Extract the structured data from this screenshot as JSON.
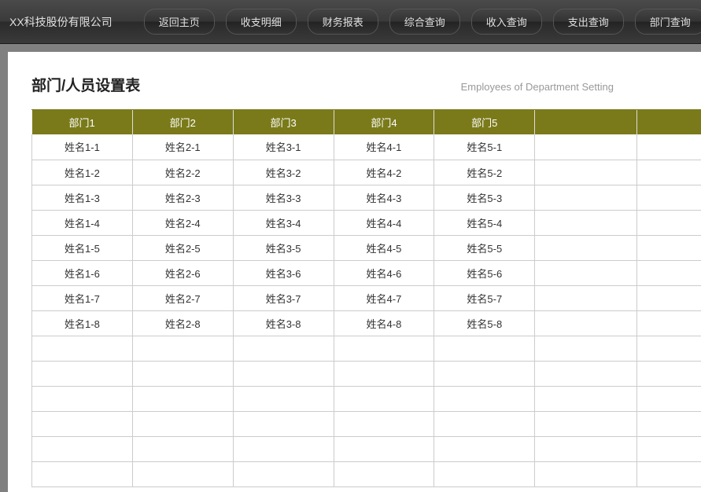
{
  "company_name": "XX科技股份有限公司",
  "nav": [
    "返回主页",
    "收支明细",
    "财务报表",
    "综合查询",
    "收入查询",
    "支出查询",
    "部门查询"
  ],
  "page_title": "部门/人员设置表",
  "page_subtitle": "Employees of Department Setting",
  "table": {
    "headers": [
      "部门1",
      "部门2",
      "部门3",
      "部门4",
      "部门5",
      "",
      ""
    ],
    "rows": [
      [
        "姓名1-1",
        "姓名2-1",
        "姓名3-1",
        "姓名4-1",
        "姓名5-1",
        "",
        ""
      ],
      [
        "姓名1-2",
        "姓名2-2",
        "姓名3-2",
        "姓名4-2",
        "姓名5-2",
        "",
        ""
      ],
      [
        "姓名1-3",
        "姓名2-3",
        "姓名3-3",
        "姓名4-3",
        "姓名5-3",
        "",
        ""
      ],
      [
        "姓名1-4",
        "姓名2-4",
        "姓名3-4",
        "姓名4-4",
        "姓名5-4",
        "",
        ""
      ],
      [
        "姓名1-5",
        "姓名2-5",
        "姓名3-5",
        "姓名4-5",
        "姓名5-5",
        "",
        ""
      ],
      [
        "姓名1-6",
        "姓名2-6",
        "姓名3-6",
        "姓名4-6",
        "姓名5-6",
        "",
        ""
      ],
      [
        "姓名1-7",
        "姓名2-7",
        "姓名3-7",
        "姓名4-7",
        "姓名5-7",
        "",
        ""
      ],
      [
        "姓名1-8",
        "姓名2-8",
        "姓名3-8",
        "姓名4-8",
        "姓名5-8",
        "",
        ""
      ],
      [
        "",
        "",
        "",
        "",
        "",
        "",
        ""
      ],
      [
        "",
        "",
        "",
        "",
        "",
        "",
        ""
      ],
      [
        "",
        "",
        "",
        "",
        "",
        "",
        ""
      ],
      [
        "",
        "",
        "",
        "",
        "",
        "",
        ""
      ],
      [
        "",
        "",
        "",
        "",
        "",
        "",
        ""
      ],
      [
        "",
        "",
        "",
        "",
        "",
        "",
        ""
      ]
    ]
  }
}
